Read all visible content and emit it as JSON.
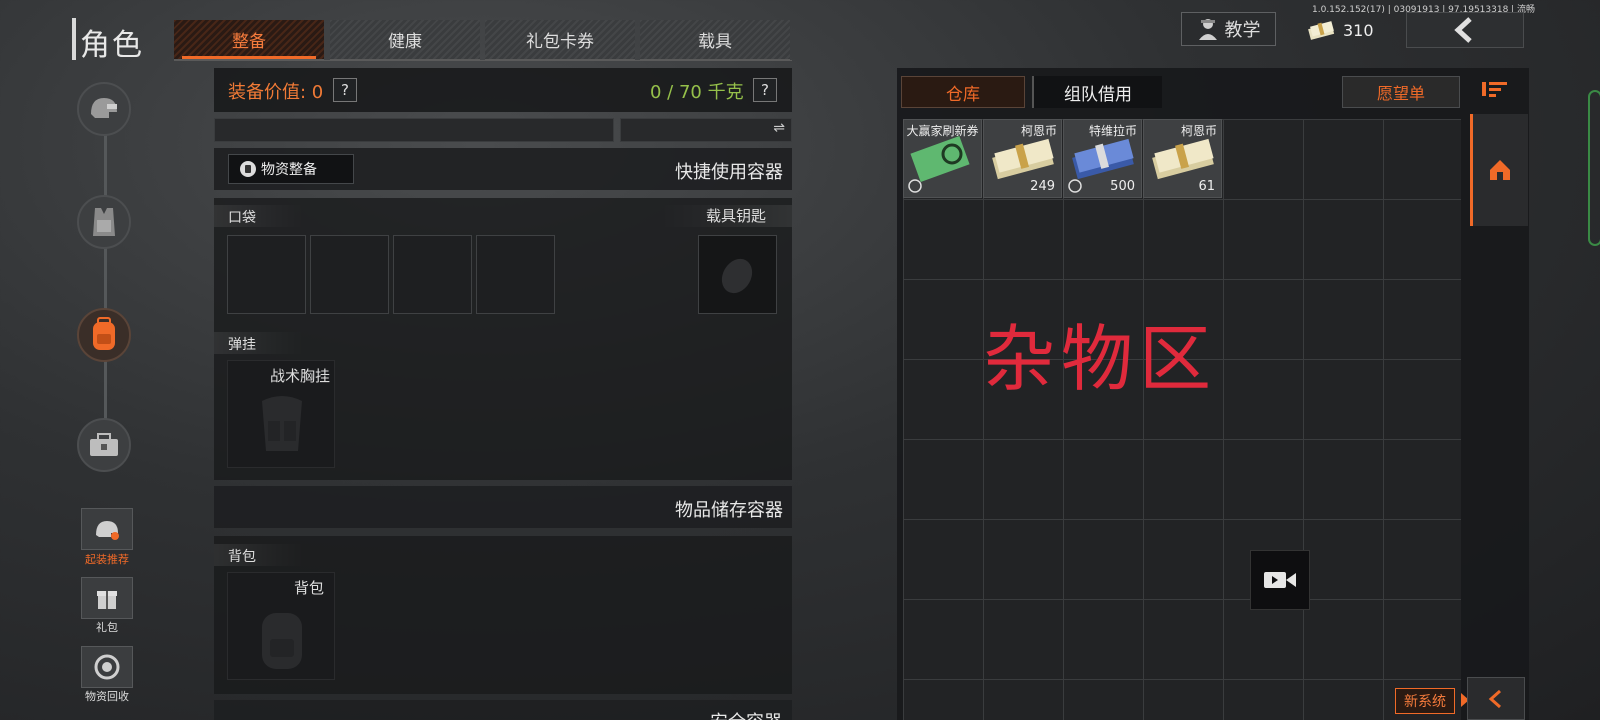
{
  "header": {
    "title": "角色",
    "tabs": [
      {
        "label": "整备",
        "active": true
      },
      {
        "label": "健康",
        "active": false
      },
      {
        "label": "礼包卡券",
        "active": false
      },
      {
        "label": "载具",
        "active": false
      }
    ],
    "tutorial_label": "教学",
    "version": "1.0.152.152(17) | 03091913 | 97.19513318 | 流畅",
    "currency_amount": "310"
  },
  "left_nav": {
    "icons": [
      "helmet-icon",
      "armor-icon",
      "backpack-icon",
      "toolbox-icon"
    ],
    "mini_buttons": [
      {
        "label": "起装推荐",
        "icon": "helmet-gear-icon",
        "highlight": true
      },
      {
        "label": "礼包",
        "icon": "gift-icon",
        "highlight": false
      },
      {
        "label": "物资回收",
        "icon": "recycle-icon",
        "highlight": false
      }
    ]
  },
  "equipment": {
    "value_label": "装备价值: 0",
    "weight_label": "0 / 70 千克",
    "help": "?",
    "swap_icon": "⇌",
    "supply_button": "物资整备",
    "quick_container": "快捷使用容器",
    "pocket_label": "口袋",
    "vehicle_key_label": "载具钥匙",
    "rig_label": "弹挂",
    "rig_item": "战术胸挂",
    "storage_container": "物品储存容器",
    "backpack_label": "背包",
    "backpack_item": "背包",
    "safe_container": "安全容器"
  },
  "warehouse": {
    "tabs": [
      {
        "label": "仓库",
        "active": true
      },
      {
        "label": "组队借用",
        "active": false
      }
    ],
    "wishlist": "愿望单",
    "zone_label": "杂物区",
    "new_system": "新系统",
    "items": [
      {
        "name": "大赢家刷新券",
        "count": "",
        "color": "#5fb870"
      },
      {
        "name": "柯恩币",
        "count": "249",
        "color": "#e8dcb0"
      },
      {
        "name": "特维拉币",
        "count": "500",
        "color": "#4f74c8"
      },
      {
        "name": "柯恩币",
        "count": "61",
        "color": "#e8dcb0"
      }
    ]
  },
  "colors": {
    "accent": "#f06a28",
    "weight_green": "#95c04a",
    "zone_red": "#e02a3c"
  }
}
